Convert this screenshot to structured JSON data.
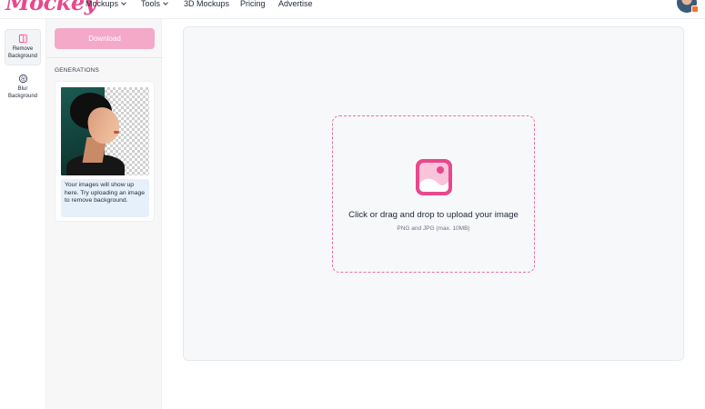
{
  "brand": {
    "logo_text": "Mockey",
    "accent": "#e9488c"
  },
  "nav": {
    "items": [
      {
        "label": "Mockups",
        "has_dropdown": true
      },
      {
        "label": "Tools",
        "has_dropdown": true
      },
      {
        "label": "3D Mockups",
        "has_dropdown": false
      },
      {
        "label": "Pricing",
        "has_dropdown": false
      },
      {
        "label": "Advertise",
        "has_dropdown": false
      }
    ],
    "avatar_icon": "user-avatar-icon"
  },
  "tools": {
    "items": [
      {
        "label_line1": "Remove",
        "label_line2": "Background",
        "icon": "remove-background-icon",
        "active": true
      },
      {
        "label_line1": "Blur",
        "label_line2": "Background",
        "icon": "blur-background-icon",
        "active": false
      }
    ]
  },
  "panel": {
    "download_label": "Download",
    "generations_title": "GENERATIONS",
    "note": "Your images will show up here. Try uploading an image to remove background."
  },
  "upload": {
    "icon": "image-upload-icon",
    "prompt": "Click or drag and drop to upload your image",
    "formats": "PNG and JPG (max. 10MB)"
  },
  "colors": {
    "accent": "#e9488c",
    "download_button": "#f4a9c8",
    "note_bg": "#e5f0fb",
    "dropzone_border": "#ec6ea4"
  }
}
